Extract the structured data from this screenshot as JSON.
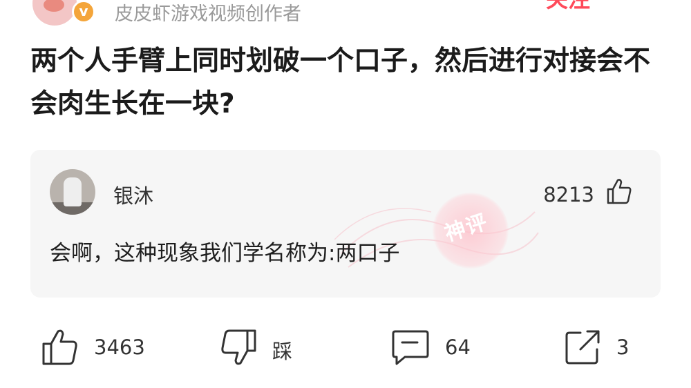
{
  "header": {
    "author_title": "皮皮虾游戏视频创作者",
    "verified_mark": "v",
    "follow_label": "关注"
  },
  "post": {
    "title": "两个人手臂上同时划破一个口子，然后进行对接会不会肉生长在一块?"
  },
  "comment": {
    "name": "银沐",
    "likes": "8213",
    "text": "会啊，这种现象我们学名称为:两口子",
    "stamp_label": "神评"
  },
  "actions": {
    "like_count": "3463",
    "dislike_label": "踩",
    "comment_count": "64",
    "share_count": "3"
  },
  "colors": {
    "accent": "#ff4a5a",
    "badge": "#f4a53a",
    "card_bg": "#f6f6f6"
  },
  "icons": [
    "like-icon",
    "dislike-icon",
    "comment-icon",
    "share-icon",
    "verified-icon"
  ]
}
